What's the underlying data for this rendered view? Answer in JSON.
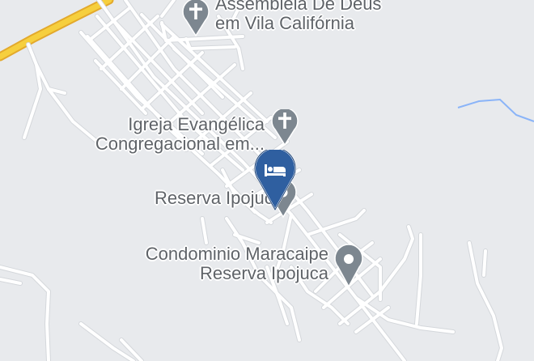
{
  "map": {
    "colors": {
      "background": "#e8eaed",
      "road": "#ffffff",
      "road_casing": "#d4d7db",
      "highway": "#f6cf3e",
      "highway_casing": "#e3a92c",
      "water": "#8ab4f8",
      "poi_pin": "#7d8790",
      "hotel_pin": "#2f5fa0"
    },
    "places": [
      {
        "id": "assembleia",
        "icon": "church-cross-icon",
        "line1": "Assembleia De Deus",
        "line2": "em Vila Califórnia"
      },
      {
        "id": "igreja",
        "icon": "church-cross-icon",
        "line1": "Igreja Evangélica",
        "line2": "Congregacional em..."
      },
      {
        "id": "reserva",
        "icon": "place-pin-icon",
        "line1": "Reserva Ipojuca",
        "line2": ""
      },
      {
        "id": "condominio",
        "icon": "place-pin-icon",
        "line1": "Condominio Maracaipe",
        "line2": "Reserva Ipojuca"
      }
    ],
    "selected_marker": {
      "icon": "hotel-bed-icon"
    }
  }
}
